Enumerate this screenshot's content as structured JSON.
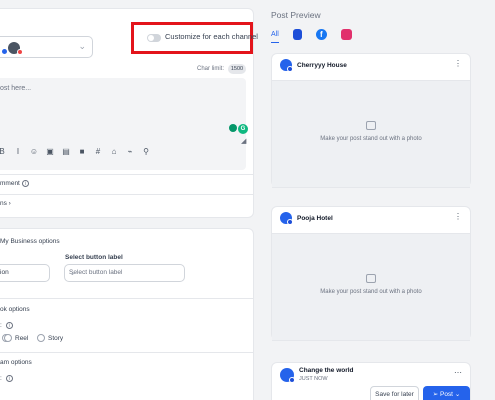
{
  "composer": {
    "customize_label": "Customize for each channel",
    "char_limit_label": "Char limit:",
    "char_limit_value": "1500",
    "editor_placeholder": "ost here...",
    "toolbar": [
      "B",
      "I",
      "☺",
      "▣",
      "▤",
      "■",
      "#",
      "⌂",
      "⌁",
      "⚲"
    ],
    "comment_label": "mment",
    "options_label": "ns",
    "gmb_options": "My Business options",
    "action_label": "ction",
    "select_button_label": "Select button label",
    "select_button_placeholder": "Select button label",
    "facebook_options": "ok options",
    "reel_label": "Reel",
    "story_label": "Story",
    "instagram_options": "am options"
  },
  "preview": {
    "title": "Post Preview",
    "tabs": [
      {
        "label": "All",
        "color": "#2563eb"
      },
      {
        "icon": "google-business-icon",
        "color": "#1d4ed8"
      },
      {
        "icon": "facebook-icon",
        "color": "#1877f2"
      },
      {
        "icon": "instagram-icon",
        "color": "#e1306c"
      }
    ],
    "cards": [
      {
        "name": "Cherryyy House",
        "hint": "Make your post stand out with a photo"
      },
      {
        "name": "Pooja Hotel",
        "hint": "Make your post stand out with a photo"
      },
      {
        "name": "Change the world",
        "time": "JUST NOW"
      }
    ]
  },
  "footer": {
    "save_label": "Save for later",
    "post_label": "Post"
  }
}
